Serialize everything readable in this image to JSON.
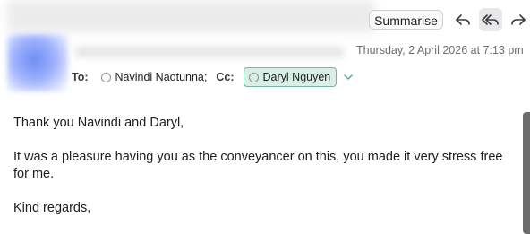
{
  "toolbar": {
    "summarise_label": "Summarise",
    "reply_icon": "reply-icon",
    "reply_all_icon": "reply-all-icon",
    "forward_icon": "forward-icon"
  },
  "message": {
    "date": "Thursday, 2 April 2026 at 7:13 pm",
    "to_label": "To:",
    "to": [
      {
        "name": "Navindi Naotunna;"
      }
    ],
    "cc_label": "Cc:",
    "cc": [
      {
        "name": "Daryl Nguyen",
        "selected": true
      }
    ],
    "body": [
      "Thank you Navindi and Daryl,",
      "It was a pleasure having you as the conveyancer on this, you made it very stress free for me.",
      "Kind regards,"
    ]
  },
  "colors": {
    "chip_bg": "#d9efe6",
    "chip_border": "#6fb89a",
    "muted_text": "#6e6e73"
  }
}
